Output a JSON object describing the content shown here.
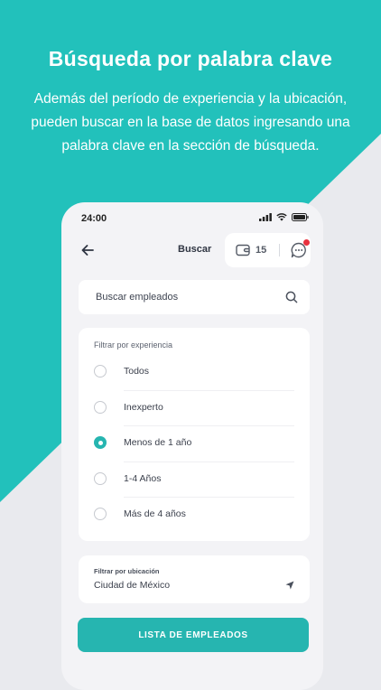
{
  "promo": {
    "title": "Búsqueda por palabra clave",
    "description": "Además del período de experiencia y la ubicación, pueden buscar en la base de datos ingresando una palabra clave en la sección de búsqueda."
  },
  "status_bar": {
    "time": "24:00"
  },
  "header": {
    "title": "Buscar",
    "wallet_count": "15"
  },
  "search": {
    "placeholder": "Buscar empleados",
    "value": ""
  },
  "experience_filter": {
    "label": "Filtrar por experiencia",
    "options": [
      "Todos",
      "Inexperto",
      "Menos de 1 año",
      "1-4 Años",
      "Más de 4 años"
    ],
    "selected": "Menos de 1 año"
  },
  "location_filter": {
    "label": "Filtrar por ubicación",
    "value": "Ciudad de México"
  },
  "cta": {
    "label": "LISTA DE EMPLEADOS"
  },
  "colors": {
    "accent": "#26b5b0",
    "teal_bg": "#22c1bb",
    "notification": "#e8323f"
  },
  "icons": {
    "back": "arrow-left-icon",
    "wallet": "wallet-icon",
    "chat": "chat-bubble-icon",
    "search": "search-icon",
    "location": "location-arrow-icon"
  }
}
